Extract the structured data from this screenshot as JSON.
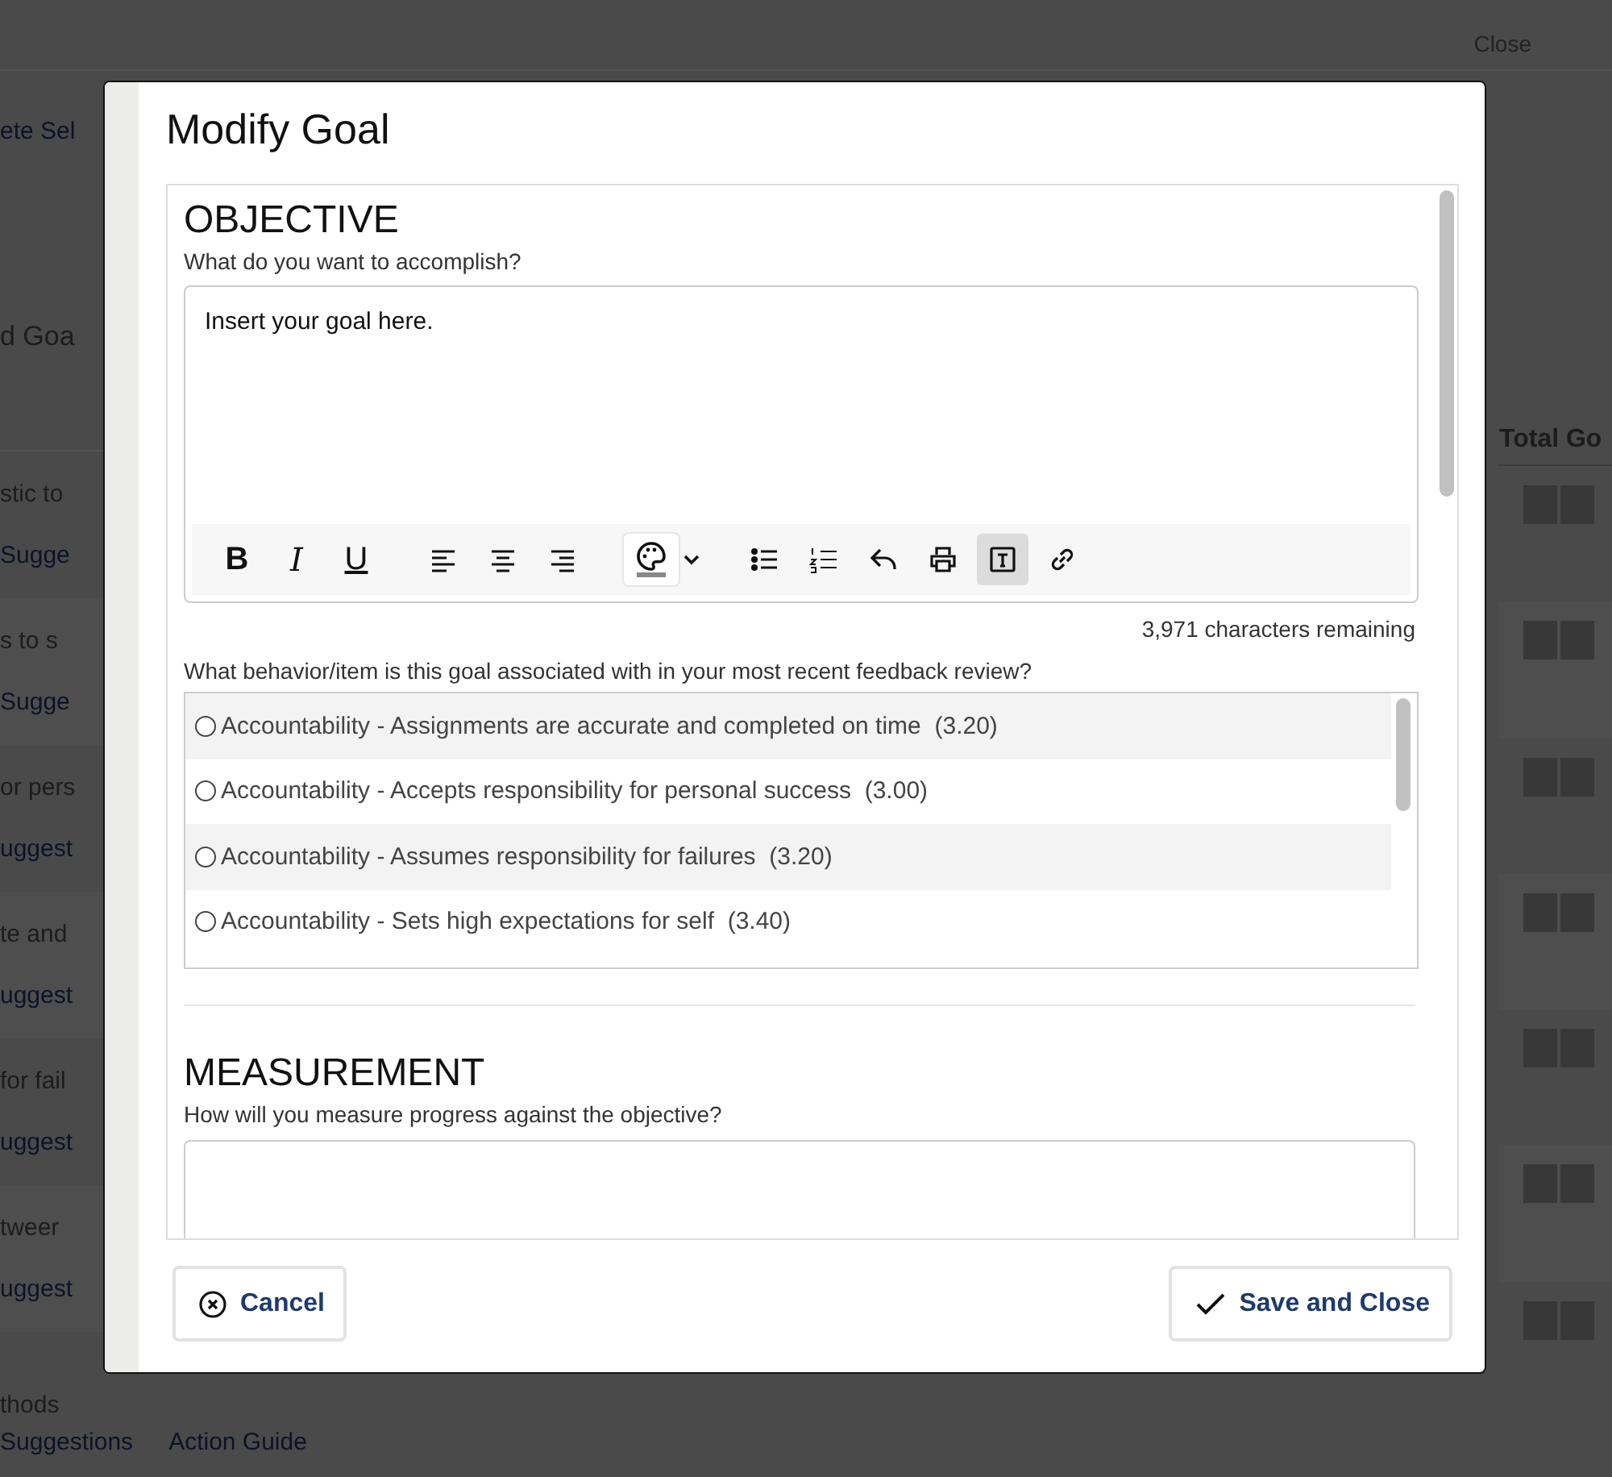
{
  "background": {
    "close_link": "Close",
    "left_texts": [
      {
        "kind": "link",
        "text": "ete Sel"
      },
      {
        "kind": "heading",
        "text": "d Goa"
      }
    ],
    "rows": [
      {
        "text": "stic to",
        "link": "Sugge"
      },
      {
        "text": "s to s",
        "link": "Sugge"
      },
      {
        "text": "or pers",
        "link": "uggest"
      },
      {
        "text": "te and",
        "link": "uggest"
      },
      {
        "text": "for fail",
        "link": "uggest"
      },
      {
        "text": "tweer",
        "link": "uggest"
      },
      {
        "text": "thods"
      }
    ],
    "column_header": "Total Go",
    "bottom_links": [
      "Suggestions",
      "Action Guide"
    ]
  },
  "modal": {
    "title": "Modify Goal",
    "objective": {
      "heading": "OBJECTIVE",
      "hint": "What do you want to accomplish?",
      "value": "Insert your goal here.",
      "toolbar": [
        {
          "kind": "bold",
          "label": "B",
          "active": false
        },
        {
          "kind": "italic",
          "label": "I",
          "active": false
        },
        {
          "kind": "underline",
          "label": "U",
          "active": false
        },
        {
          "kind": "align-left",
          "active": false
        },
        {
          "kind": "align-center",
          "active": false
        },
        {
          "kind": "align-right",
          "active": false
        },
        {
          "kind": "color",
          "active": true
        },
        {
          "kind": "bullets",
          "active": false
        },
        {
          "kind": "numbers",
          "active": false
        },
        {
          "kind": "undo",
          "active": false
        },
        {
          "kind": "print",
          "active": false
        },
        {
          "kind": "format",
          "active": true
        },
        {
          "kind": "link",
          "active": false
        }
      ],
      "remaining": "3,971 characters remaining"
    },
    "question": "What behavior/item is this goal associated with in your most recent feedback review?",
    "options": [
      {
        "label": "Accountability - Assignments are accurate and completed on time  (3.20)",
        "selected": false
      },
      {
        "label": "Accountability - Accepts responsibility for personal success  (3.00)",
        "selected": false
      },
      {
        "label": "Accountability - Assumes responsibility for failures  (3.20)",
        "selected": false
      },
      {
        "label": "Accountability - Sets high expectations for self  (3.40)",
        "selected": false
      }
    ],
    "measurement": {
      "heading": "MEASUREMENT",
      "hint": "How will you measure progress against the objective?"
    },
    "cancel": "Cancel",
    "save": "Save and Close"
  }
}
